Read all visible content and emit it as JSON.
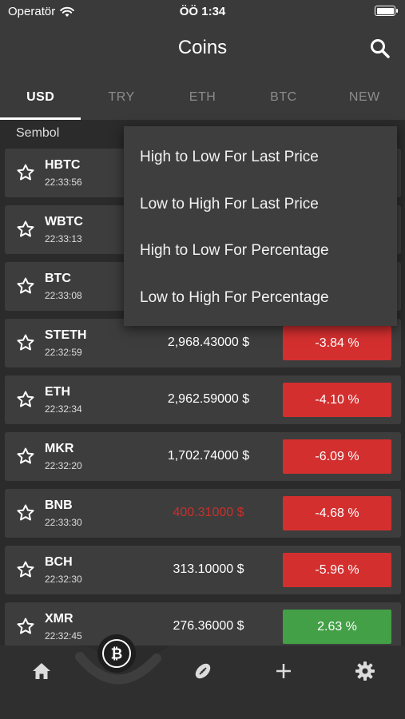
{
  "status": {
    "carrier": "Operatör",
    "time": "ÖÖ 1:34"
  },
  "header": {
    "title": "Coins"
  },
  "tabs": [
    "USD",
    "TRY",
    "ETH",
    "BTC",
    "NEW"
  ],
  "list_header": {
    "symbol": "Sembol"
  },
  "coins": [
    {
      "symbol": "HBTC",
      "time": "22:33:56",
      "price": "",
      "change": "",
      "trend": "neg"
    },
    {
      "symbol": "WBTC",
      "time": "22:33:13",
      "price": "",
      "change": "",
      "trend": "neg"
    },
    {
      "symbol": "BTC",
      "time": "22:33:08",
      "price": "",
      "change": "",
      "trend": "neg"
    },
    {
      "symbol": "STETH",
      "time": "22:32:59",
      "price": "2,968.43000 $",
      "change": "-3.84 %",
      "trend": "neg"
    },
    {
      "symbol": "ETH",
      "time": "22:32:34",
      "price": "2,962.59000 $",
      "change": "-4.10 %",
      "trend": "neg"
    },
    {
      "symbol": "MKR",
      "time": "22:32:20",
      "price": "1,702.74000 $",
      "change": "-6.09 %",
      "trend": "neg"
    },
    {
      "symbol": "BNB",
      "time": "22:33:30",
      "price": "400.31000 $",
      "change": "-4.68 %",
      "trend": "neg",
      "price_color": "red"
    },
    {
      "symbol": "BCH",
      "time": "22:32:30",
      "price": "313.10000 $",
      "change": "-5.96 %",
      "trend": "neg"
    },
    {
      "symbol": "XMR",
      "time": "22:32:45",
      "price": "276.36000 $",
      "change": "2.63 %",
      "trend": "pos"
    }
  ],
  "sort_menu": [
    "High to Low For Last Price",
    "Low to High For Last Price",
    "High to Low For Percentage",
    "Low to High For Percentage"
  ],
  "bottom_nav": {
    "icons": [
      "home-icon",
      "bitcoin-icon",
      "football-icon",
      "plus-icon",
      "gear-icon"
    ]
  },
  "colors": {
    "negative": "#d32f2f",
    "positive": "#43a047",
    "red_price": "#c9302c"
  }
}
